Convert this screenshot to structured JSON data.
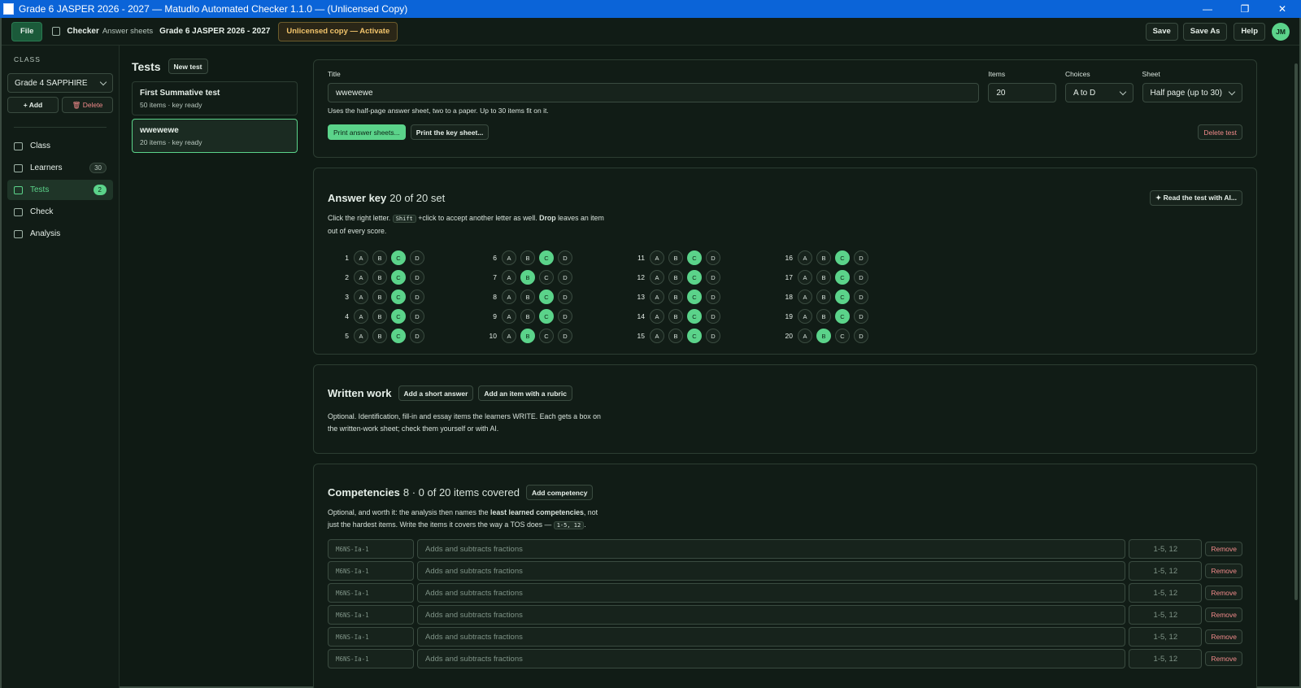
{
  "window": {
    "title": "Grade 6 JASPER 2026 - 2027  —  Matudlo Automated Checker 1.1.0  —  (Unlicensed Copy)",
    "min": "—",
    "max": "❐",
    "close": "✕"
  },
  "topbar": {
    "file": "File",
    "app_name": "Checker",
    "app_sub": "Answer sheets",
    "class_name": "Grade 6 JASPER 2026 - 2027",
    "unlicensed": "Unlicensed copy — Activate",
    "save": "Save",
    "save_as": "Save As",
    "help": "Help",
    "avatar": "JM"
  },
  "sidebar": {
    "caption": "CLASS",
    "class_select": "Grade 4 SAPPHIRE",
    "add": "+ Add",
    "delete": "🗑 Delete",
    "items": [
      {
        "label": "Class",
        "count": "",
        "icon": "class-icon"
      },
      {
        "label": "Learners",
        "count": "30",
        "icon": "learners-icon"
      },
      {
        "label": "Tests",
        "count": "2",
        "icon": "tests-icon"
      },
      {
        "label": "Check",
        "count": "",
        "icon": "check-icon"
      },
      {
        "label": "Analysis",
        "count": "",
        "icon": "analysis-icon"
      }
    ]
  },
  "tests": {
    "heading": "Tests",
    "new_test": "New test",
    "list": [
      {
        "name": "First Summative test",
        "meta": "50 items · key ready"
      },
      {
        "name": "wwewewe",
        "meta": "20 items · key ready"
      }
    ]
  },
  "test_form": {
    "title_label": "Title",
    "title_value": "wwewewe",
    "items_label": "Items",
    "items_value": "20",
    "choices_label": "Choices",
    "choices_value": "A to D",
    "sheet_label": "Sheet",
    "sheet_value": "Half page (up to 30)",
    "hint": "Uses the half-page answer sheet, two to a paper. Up to 30 items fit on it.",
    "print_sheets": "Print answer sheets...",
    "print_key": "Print the key sheet...",
    "delete_test": "Delete test"
  },
  "answer_key": {
    "title": "Answer key",
    "status": "20 of 20 set",
    "read_ai": "✦ Read the test with AI...",
    "desc_1": "Click the right letter. ",
    "desc_kbd": "Shift",
    "desc_2": " +click to accept another letter as well. ",
    "desc_bold": "Drop",
    "desc_3": " leaves an item out of every score.",
    "letters": [
      "A",
      "B",
      "C",
      "D"
    ],
    "items": [
      {
        "n": "1",
        "ans": "C"
      },
      {
        "n": "2",
        "ans": "C"
      },
      {
        "n": "3",
        "ans": "C"
      },
      {
        "n": "4",
        "ans": "C"
      },
      {
        "n": "5",
        "ans": "C"
      },
      {
        "n": "6",
        "ans": "C"
      },
      {
        "n": "7",
        "ans": "B"
      },
      {
        "n": "8",
        "ans": "C"
      },
      {
        "n": "9",
        "ans": "C"
      },
      {
        "n": "10",
        "ans": "B"
      },
      {
        "n": "11",
        "ans": "C"
      },
      {
        "n": "12",
        "ans": "C"
      },
      {
        "n": "13",
        "ans": "C"
      },
      {
        "n": "14",
        "ans": "C"
      },
      {
        "n": "15",
        "ans": "C"
      },
      {
        "n": "16",
        "ans": "C"
      },
      {
        "n": "17",
        "ans": "C"
      },
      {
        "n": "18",
        "ans": "C"
      },
      {
        "n": "19",
        "ans": "C"
      },
      {
        "n": "20",
        "ans": "B"
      }
    ]
  },
  "written": {
    "title": "Written work",
    "add_short": "Add a short answer",
    "add_rubric": "Add an item with a rubric",
    "desc": "Optional. Identification, fill-in and essay items the learners WRITE. Each gets a box on the written-work sheet; check them yourself or with AI."
  },
  "competencies": {
    "title": "Competencies",
    "status": "8 · 0 of 20 items covered",
    "add": "Add competency",
    "desc_1": "Optional, and worth it: the analysis then names the ",
    "desc_bold": "least learned competencies",
    "desc_2": ", not just the hardest items. Write the items it covers the way a TOS does — ",
    "desc_kbd": "1-5, 12",
    "desc_3": ".",
    "rows": [
      {
        "code": "M6NS-Ia-1",
        "name": "Adds and subtracts fractions",
        "items": "1-5, 12",
        "remove": "Remove"
      },
      {
        "code": "M6NS-Ia-1",
        "name": "Adds and subtracts fractions",
        "items": "1-5, 12",
        "remove": "Remove"
      },
      {
        "code": "M6NS-Ia-1",
        "name": "Adds and subtracts fractions",
        "items": "1-5, 12",
        "remove": "Remove"
      },
      {
        "code": "M6NS-Ia-1",
        "name": "Adds and subtracts fractions",
        "items": "1-5, 12",
        "remove": "Remove"
      },
      {
        "code": "M6NS-Ia-1",
        "name": "Adds and subtracts fractions",
        "items": "1-5, 12",
        "remove": "Remove"
      },
      {
        "code": "M6NS-Ia-1",
        "name": "Adds and subtracts fractions",
        "items": "1-5, 12",
        "remove": "Remove"
      }
    ]
  },
  "colors": {
    "accent": "#5bd38a",
    "bg": "#0f1a14",
    "danger": "#f08a8a",
    "warn": "#f2c46b",
    "titlebar": "#0b64d8"
  }
}
